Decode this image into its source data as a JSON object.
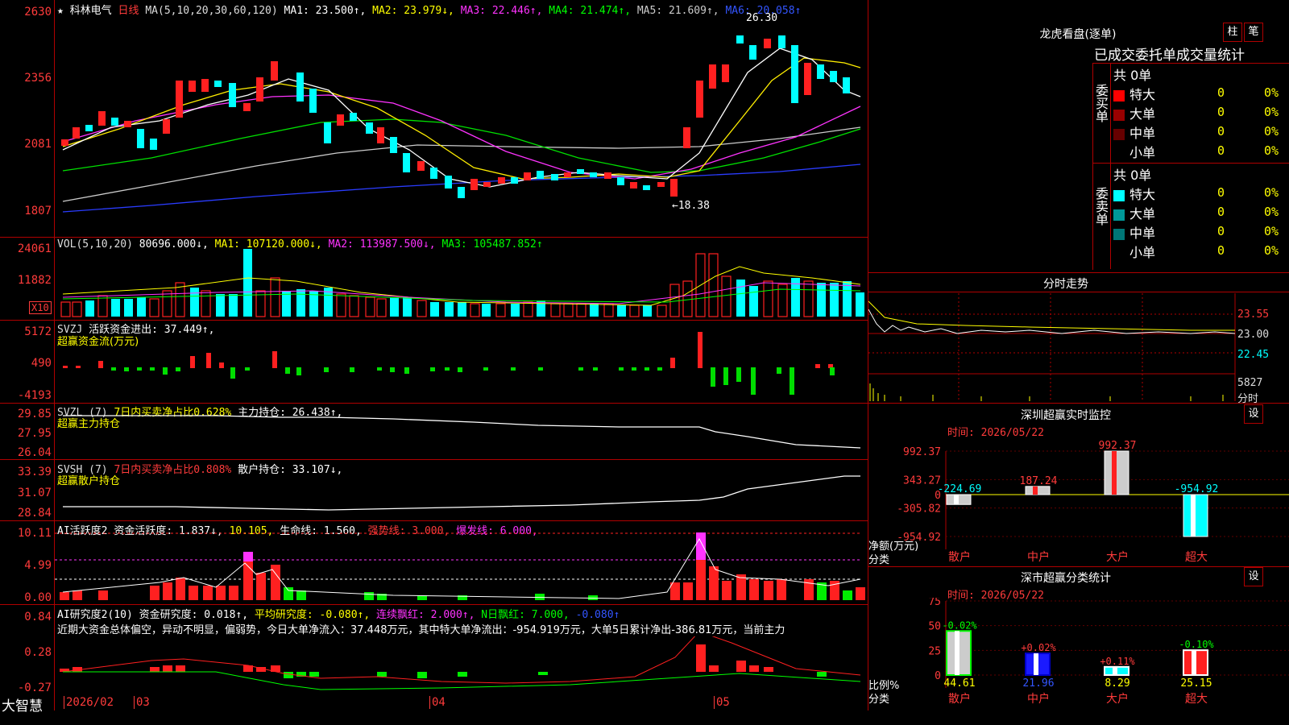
{
  "main_chart": {
    "star": "★",
    "stock_name": "科林电气",
    "period": "日线",
    "ma_label": "MA(5,10,20,30,60,120)",
    "ma1": "MA1: 23.500↑,",
    "ma2": "MA2: 23.979↓,",
    "ma3": "MA3: 22.446↑,",
    "ma4": "MA4: 21.474↑,",
    "ma5": "MA5: 21.609↑,",
    "ma6": "MA6: 20.058↑",
    "y_labels": [
      "2630",
      "2356",
      "2081",
      "1807"
    ],
    "high_note": "26.30",
    "low_note": "←18.38"
  },
  "vol_panel": {
    "label": "VOL(5,10,20)",
    "value": "80696.000↓,",
    "ma1": "MA1: 107120.000↓,",
    "ma2": "MA2: 113987.500↓,",
    "ma3": "MA3: 105487.852↑",
    "y_labels": [
      "24061",
      "11882"
    ],
    "unit": "X10"
  },
  "svzj_panel": {
    "label": "SVZJ",
    "text": "活跃资金进出: 37.449↑,",
    "subtitle": "超赢资金流(万元)",
    "y_labels": [
      "5172",
      "490",
      "-4193"
    ]
  },
  "svzl_panel": {
    "label": "SVZL (7)",
    "ratio": "7日内买卖净占比0.628%",
    "hold": "主力持仓: 26.438↑,",
    "subtitle": "超赢主力持仓",
    "y_labels": [
      "29.85",
      "27.95",
      "26.04"
    ]
  },
  "svsh_panel": {
    "label": "SVSH (7)",
    "ratio": "7日内买卖净占比0.808%",
    "hold": "散户持仓: 33.107↓,",
    "subtitle": "超赢散户持仓",
    "y_labels": [
      "33.39",
      "31.07",
      "28.84"
    ]
  },
  "ai_active_panel": {
    "label": "AI活跃度2",
    "fund": "资金活跃度: 1.837↓,",
    "v2": "10.105,",
    "life": "生命线: 1.560,",
    "strong": "强势线: 3.000,",
    "burst": "爆发线: 6.000,",
    "y_labels": [
      "10.11",
      "4.99",
      "0.00"
    ]
  },
  "ai_research_panel": {
    "label": "AI研究度2(10)",
    "fund": "资金研究度: 0.018↑,",
    "avg": "平均研究度: -0.080↑,",
    "streak": "连续飘红: 2.000↑,",
    "nday": "N日飘红: 7.000,",
    "last": "-0.080↑",
    "summary": "近期大资金总体偏空，异动不明显，偏弱势，今日大单净流入：37.448万元，其中特大单净流出：-954.919万元，大单5日累计净出-386.81万元，当前主力",
    "y_labels": [
      "0.84",
      "0.28",
      "-0.27"
    ]
  },
  "bottom_bar": {
    "brand": "大智慧",
    "dates": [
      "2026/02",
      "03",
      "04",
      "05"
    ]
  },
  "dragon_tiger": {
    "title": "龙虎看盘(逐单)",
    "btn_bar": "柱",
    "btn_brush": "笔",
    "stats_header": "已成交委托单成交量统计",
    "buy": {
      "side_label": "委买单",
      "total": "共 0单",
      "rows": [
        {
          "name": "特大",
          "count": "0",
          "pct": "0%",
          "color": "#ff0000"
        },
        {
          "name": "大单",
          "count": "0",
          "pct": "0%",
          "color": "#990000"
        },
        {
          "name": "中单",
          "count": "0",
          "pct": "0%",
          "color": "#660000"
        },
        {
          "name": "小单",
          "count": "0",
          "pct": "0%",
          "color": ""
        }
      ]
    },
    "sell": {
      "side_label": "委卖单",
      "total": "共 0单",
      "rows": [
        {
          "name": "特大",
          "count": "0",
          "pct": "0%",
          "color": "#00ffff"
        },
        {
          "name": "大单",
          "count": "0",
          "pct": "0%",
          "color": "#009999"
        },
        {
          "name": "中单",
          "count": "0",
          "pct": "0%",
          "color": "#007777"
        },
        {
          "name": "小单",
          "count": "0",
          "pct": "0%",
          "color": ""
        }
      ]
    }
  },
  "intraday": {
    "title": "分时走势",
    "price_labels": [
      "23.55",
      "23.00",
      "22.45"
    ],
    "vol_label": "5827",
    "vol_unit": "分时"
  },
  "monitor": {
    "title": "深圳超赢实时监控",
    "settings": "设",
    "time": "时间: 2026/05/22",
    "y_labels": [
      "992.37",
      "343.27",
      "0",
      "-305.82",
      "-954.92"
    ],
    "axis_label": "净额(万元)",
    "category_label": "分类",
    "categories": [
      "散户",
      "中户",
      "大户",
      "超大"
    ],
    "values": [
      -224.69,
      187.24,
      992.37,
      -954.92
    ],
    "value_labels": [
      "-224.69",
      "187.24",
      "992.37",
      "-954.92"
    ]
  },
  "classify": {
    "title": "深市超赢分类统计",
    "settings": "设",
    "time": "时间: 2026/05/22",
    "y_labels": [
      "75",
      "50",
      "25",
      "0"
    ],
    "axis_label": "比例%",
    "category_label": "分类",
    "categories": [
      "散户",
      "中户",
      "大户",
      "超大"
    ],
    "values": [
      44.61,
      21.96,
      8.29,
      25.15
    ],
    "value_labels": [
      "44.61",
      "21.96",
      "8.29",
      "25.15"
    ],
    "changes": [
      "-0.02%",
      "+0.02%",
      "+0.11%",
      "-0.10%"
    ]
  },
  "chart_data": [
    {
      "type": "bar",
      "title": "深圳超赢实时监控",
      "ylabel": "净额(万元)",
      "categories": [
        "散户",
        "中户",
        "大户",
        "超大"
      ],
      "values": [
        -224.69,
        187.24,
        992.37,
        -954.92
      ],
      "ylim": [
        -954.92,
        992.37
      ]
    },
    {
      "type": "bar",
      "title": "深市超赢分类统计",
      "ylabel": "比例%",
      "categories": [
        "散户",
        "中户",
        "大户",
        "超大"
      ],
      "values": [
        44.61,
        21.96,
        8.29,
        25.15
      ],
      "ylim": [
        0,
        75
      ]
    }
  ]
}
